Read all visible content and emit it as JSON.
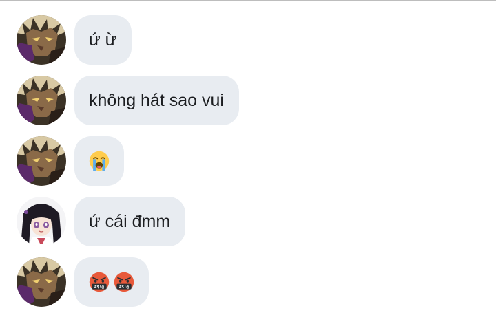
{
  "messages": [
    {
      "sender": "male",
      "text": "ứ ừ"
    },
    {
      "sender": "male",
      "text": "không hát sao vui"
    },
    {
      "sender": "male",
      "emoji": [
        "loudly-crying-face"
      ]
    },
    {
      "sender": "female",
      "text": "ứ cái đmm"
    },
    {
      "sender": "male",
      "emoji": [
        "face-with-symbols-on-mouth",
        "face-with-symbols-on-mouth"
      ]
    }
  ],
  "colors": {
    "bubble": "#e8ecf1",
    "text": "#1c1e21"
  }
}
